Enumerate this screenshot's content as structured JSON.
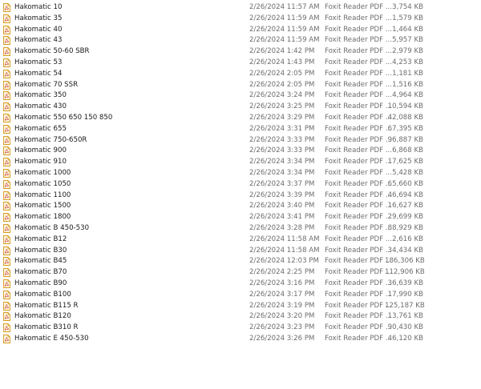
{
  "files": [
    {
      "name": "Hakomatic 10",
      "date": "2/26/2024 11:57 AM",
      "type": "Foxit Reader PDF ...",
      "size": "3,754 KB"
    },
    {
      "name": "Hakomatic 35",
      "date": "2/26/2024 11:59 AM",
      "type": "Foxit Reader PDF ...",
      "size": "1,579 KB"
    },
    {
      "name": "Hakomatic 40",
      "date": "2/26/2024 11:59 AM",
      "type": "Foxit Reader PDF ...",
      "size": "1,464 KB"
    },
    {
      "name": "Hakomatic 43",
      "date": "2/26/2024 11:59 AM",
      "type": "Foxit Reader PDF ...",
      "size": "5,957 KB"
    },
    {
      "name": "Hakomatic 50-60 SBR",
      "date": "2/26/2024 1:42 PM",
      "type": "Foxit Reader PDF ...",
      "size": "2,979 KB"
    },
    {
      "name": "Hakomatic 53",
      "date": "2/26/2024 1:43 PM",
      "type": "Foxit Reader PDF ...",
      "size": "4,253 KB"
    },
    {
      "name": "Hakomatic 54",
      "date": "2/26/2024 2:05 PM",
      "type": "Foxit Reader PDF ...",
      "size": "1,181 KB"
    },
    {
      "name": "Hakomatic 70 SSR",
      "date": "2/26/2024 2:05 PM",
      "type": "Foxit Reader PDF ...",
      "size": "1,516 KB"
    },
    {
      "name": "Hakomatic 350",
      "date": "2/26/2024 3:24 PM",
      "type": "Foxit Reader PDF ...",
      "size": "4,964 KB"
    },
    {
      "name": "Hakomatic 430",
      "date": "2/26/2024 3:25 PM",
      "type": "Foxit Reader PDF ...",
      "size": "10,594 KB"
    },
    {
      "name": "Hakomatic 550 650 150 850",
      "date": "2/26/2024 3:29 PM",
      "type": "Foxit Reader PDF ...",
      "size": "42,088 KB"
    },
    {
      "name": "Hakomatic 655",
      "date": "2/26/2024 3:31 PM",
      "type": "Foxit Reader PDF ...",
      "size": "67,395 KB"
    },
    {
      "name": "Hakomatic 750-650R",
      "date": "2/26/2024 3:33 PM",
      "type": "Foxit Reader PDF ...",
      "size": "96,887 KB"
    },
    {
      "name": "Hakomatic 900",
      "date": "2/26/2024 3:33 PM",
      "type": "Foxit Reader PDF ...",
      "size": "6,868 KB"
    },
    {
      "name": "Hakomatic 910",
      "date": "2/26/2024 3:34 PM",
      "type": "Foxit Reader PDF ...",
      "size": "17,625 KB"
    },
    {
      "name": "Hakomatic 1000",
      "date": "2/26/2024 3:34 PM",
      "type": "Foxit Reader PDF ...",
      "size": "5,428 KB"
    },
    {
      "name": "Hakomatic 1050",
      "date": "2/26/2024 3:37 PM",
      "type": "Foxit Reader PDF ...",
      "size": "65,660 KB"
    },
    {
      "name": "Hakomatic 1100",
      "date": "2/26/2024 3:39 PM",
      "type": "Foxit Reader PDF ...",
      "size": "46,694 KB"
    },
    {
      "name": "Hakomatic 1500",
      "date": "2/26/2024 3:40 PM",
      "type": "Foxit Reader PDF ...",
      "size": "16,627 KB"
    },
    {
      "name": "Hakomatic 1800",
      "date": "2/26/2024 3:41 PM",
      "type": "Foxit Reader PDF ...",
      "size": "29,699 KB"
    },
    {
      "name": "Hakomatic B 450-530",
      "date": "2/26/2024 3:28 PM",
      "type": "Foxit Reader PDF ...",
      "size": "88,929 KB"
    },
    {
      "name": "Hakomatic B12",
      "date": "2/26/2024 11:58 AM",
      "type": "Foxit Reader PDF ...",
      "size": "2,616 KB"
    },
    {
      "name": "Hakomatic B30",
      "date": "2/26/2024 11:58 AM",
      "type": "Foxit Reader PDF ...",
      "size": "34,434 KB"
    },
    {
      "name": "Hakomatic B45",
      "date": "2/26/2024 12:03 PM",
      "type": "Foxit Reader PDF ...",
      "size": "186,306 KB"
    },
    {
      "name": "Hakomatic B70",
      "date": "2/26/2024 2:25 PM",
      "type": "Foxit Reader PDF ...",
      "size": "112,906 KB"
    },
    {
      "name": "Hakomatic B90",
      "date": "2/26/2024 3:16 PM",
      "type": "Foxit Reader PDF ...",
      "size": "36,639 KB"
    },
    {
      "name": "Hakomatic B100",
      "date": "2/26/2024 3:17 PM",
      "type": "Foxit Reader PDF ...",
      "size": "17,990 KB"
    },
    {
      "name": "Hakomatic B115 R",
      "date": "2/26/2024 3:19 PM",
      "type": "Foxit Reader PDF ...",
      "size": "125,187 KB"
    },
    {
      "name": "Hakomatic B120",
      "date": "2/26/2024 3:20 PM",
      "type": "Foxit Reader PDF ...",
      "size": "13,761 KB"
    },
    {
      "name": "Hakomatic B310 R",
      "date": "2/26/2024 3:23 PM",
      "type": "Foxit Reader PDF ...",
      "size": "90,430 KB"
    },
    {
      "name": "Hakomatic E 450-530",
      "date": "2/26/2024 3:26 PM",
      "type": "Foxit Reader PDF ...",
      "size": "46,120 KB"
    }
  ],
  "icon": {
    "name": "pdf-file-icon",
    "color": "#d99a1e",
    "fill": "#fff6e0"
  }
}
